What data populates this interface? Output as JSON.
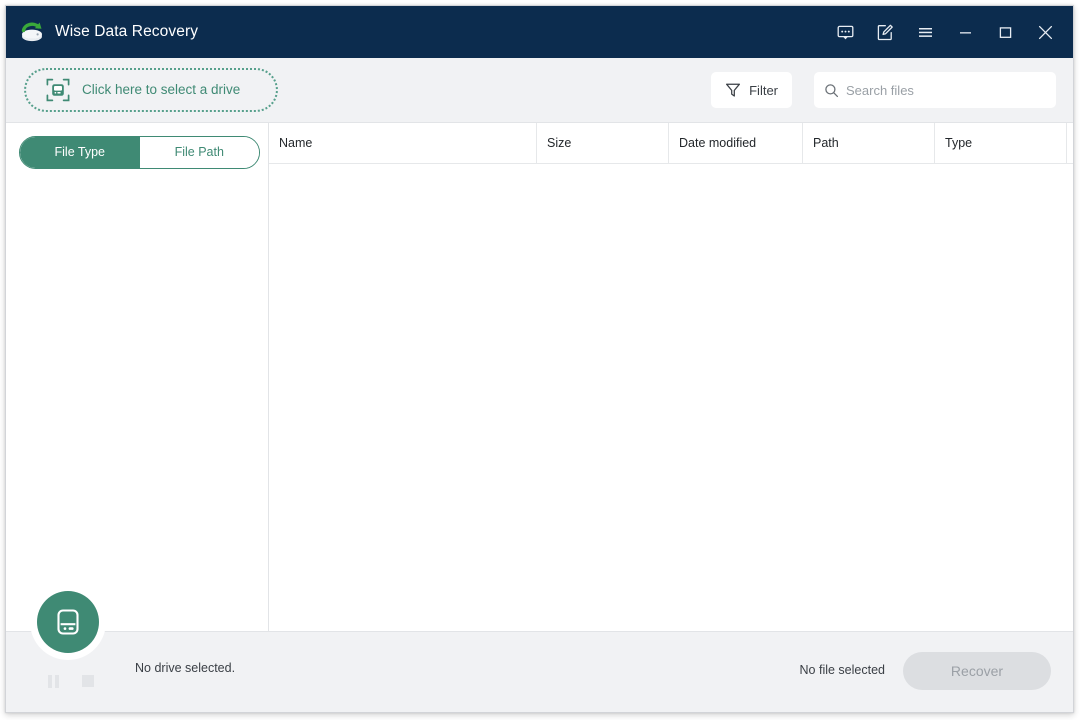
{
  "window": {
    "title": "Wise Data Recovery",
    "logo_icon": "drive-refresh-logo-icon"
  },
  "titlebar": {
    "buttons": [
      {
        "name": "feedback-button",
        "icon": "chat-bubble-icon",
        "label": "Feedback"
      },
      {
        "name": "notes-button",
        "icon": "edit-note-icon",
        "label": "Notes"
      },
      {
        "name": "menu-button",
        "icon": "hamburger-menu-icon",
        "label": "Menu"
      },
      {
        "name": "minimize-button",
        "icon": "minimize-icon",
        "label": "Minimize"
      },
      {
        "name": "maximize-button",
        "icon": "maximize-icon",
        "label": "Maximize"
      },
      {
        "name": "close-button",
        "icon": "close-icon",
        "label": "Close"
      }
    ]
  },
  "toolbar": {
    "drive_select_label": "Click here to select a drive",
    "drive_select_icon": "drive-scan-frame-icon",
    "filter_label": "Filter",
    "filter_icon": "funnel-icon",
    "search": {
      "icon": "search-icon",
      "placeholder": "Search files",
      "value": ""
    }
  },
  "sidebar": {
    "segments": [
      {
        "label": "File Type",
        "active": true
      },
      {
        "label": "File Path",
        "active": false
      }
    ],
    "items": []
  },
  "table": {
    "columns": [
      {
        "label": "Name"
      },
      {
        "label": "Size"
      },
      {
        "label": "Date modified"
      },
      {
        "label": "Path"
      },
      {
        "label": "Type"
      }
    ],
    "rows": []
  },
  "statusbar": {
    "drive_status": "No drive selected.",
    "file_status": "No file selected",
    "recover_label": "Recover",
    "recover_enabled": false,
    "drive_fab_icon": "hard-drive-icon",
    "transport": [
      {
        "name": "pause-button",
        "icon": "pause-icon"
      },
      {
        "name": "stop-button",
        "icon": "stop-icon"
      }
    ]
  },
  "colors": {
    "titlebar_bg": "#0c2c4e",
    "accent_green": "#3f8a74",
    "toolbar_bg": "#f1f2f4",
    "content_bg": "#ffffff",
    "disabled_gray": "#dcdee1"
  }
}
